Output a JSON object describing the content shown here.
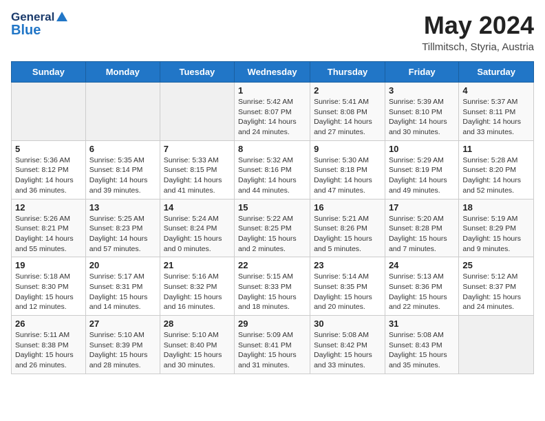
{
  "header": {
    "logo_line1": "General",
    "logo_line2": "Blue",
    "month": "May 2024",
    "location": "Tillmitsch, Styria, Austria"
  },
  "weekdays": [
    "Sunday",
    "Monday",
    "Tuesday",
    "Wednesday",
    "Thursday",
    "Friday",
    "Saturday"
  ],
  "weeks": [
    [
      {
        "day": "",
        "info": ""
      },
      {
        "day": "",
        "info": ""
      },
      {
        "day": "",
        "info": ""
      },
      {
        "day": "1",
        "info": "Sunrise: 5:42 AM\nSunset: 8:07 PM\nDaylight: 14 hours and 24 minutes."
      },
      {
        "day": "2",
        "info": "Sunrise: 5:41 AM\nSunset: 8:08 PM\nDaylight: 14 hours and 27 minutes."
      },
      {
        "day": "3",
        "info": "Sunrise: 5:39 AM\nSunset: 8:10 PM\nDaylight: 14 hours and 30 minutes."
      },
      {
        "day": "4",
        "info": "Sunrise: 5:37 AM\nSunset: 8:11 PM\nDaylight: 14 hours and 33 minutes."
      }
    ],
    [
      {
        "day": "5",
        "info": "Sunrise: 5:36 AM\nSunset: 8:12 PM\nDaylight: 14 hours and 36 minutes."
      },
      {
        "day": "6",
        "info": "Sunrise: 5:35 AM\nSunset: 8:14 PM\nDaylight: 14 hours and 39 minutes."
      },
      {
        "day": "7",
        "info": "Sunrise: 5:33 AM\nSunset: 8:15 PM\nDaylight: 14 hours and 41 minutes."
      },
      {
        "day": "8",
        "info": "Sunrise: 5:32 AM\nSunset: 8:16 PM\nDaylight: 14 hours and 44 minutes."
      },
      {
        "day": "9",
        "info": "Sunrise: 5:30 AM\nSunset: 8:18 PM\nDaylight: 14 hours and 47 minutes."
      },
      {
        "day": "10",
        "info": "Sunrise: 5:29 AM\nSunset: 8:19 PM\nDaylight: 14 hours and 49 minutes."
      },
      {
        "day": "11",
        "info": "Sunrise: 5:28 AM\nSunset: 8:20 PM\nDaylight: 14 hours and 52 minutes."
      }
    ],
    [
      {
        "day": "12",
        "info": "Sunrise: 5:26 AM\nSunset: 8:21 PM\nDaylight: 14 hours and 55 minutes."
      },
      {
        "day": "13",
        "info": "Sunrise: 5:25 AM\nSunset: 8:23 PM\nDaylight: 14 hours and 57 minutes."
      },
      {
        "day": "14",
        "info": "Sunrise: 5:24 AM\nSunset: 8:24 PM\nDaylight: 15 hours and 0 minutes."
      },
      {
        "day": "15",
        "info": "Sunrise: 5:22 AM\nSunset: 8:25 PM\nDaylight: 15 hours and 2 minutes."
      },
      {
        "day": "16",
        "info": "Sunrise: 5:21 AM\nSunset: 8:26 PM\nDaylight: 15 hours and 5 minutes."
      },
      {
        "day": "17",
        "info": "Sunrise: 5:20 AM\nSunset: 8:28 PM\nDaylight: 15 hours and 7 minutes."
      },
      {
        "day": "18",
        "info": "Sunrise: 5:19 AM\nSunset: 8:29 PM\nDaylight: 15 hours and 9 minutes."
      }
    ],
    [
      {
        "day": "19",
        "info": "Sunrise: 5:18 AM\nSunset: 8:30 PM\nDaylight: 15 hours and 12 minutes."
      },
      {
        "day": "20",
        "info": "Sunrise: 5:17 AM\nSunset: 8:31 PM\nDaylight: 15 hours and 14 minutes."
      },
      {
        "day": "21",
        "info": "Sunrise: 5:16 AM\nSunset: 8:32 PM\nDaylight: 15 hours and 16 minutes."
      },
      {
        "day": "22",
        "info": "Sunrise: 5:15 AM\nSunset: 8:33 PM\nDaylight: 15 hours and 18 minutes."
      },
      {
        "day": "23",
        "info": "Sunrise: 5:14 AM\nSunset: 8:35 PM\nDaylight: 15 hours and 20 minutes."
      },
      {
        "day": "24",
        "info": "Sunrise: 5:13 AM\nSunset: 8:36 PM\nDaylight: 15 hours and 22 minutes."
      },
      {
        "day": "25",
        "info": "Sunrise: 5:12 AM\nSunset: 8:37 PM\nDaylight: 15 hours and 24 minutes."
      }
    ],
    [
      {
        "day": "26",
        "info": "Sunrise: 5:11 AM\nSunset: 8:38 PM\nDaylight: 15 hours and 26 minutes."
      },
      {
        "day": "27",
        "info": "Sunrise: 5:10 AM\nSunset: 8:39 PM\nDaylight: 15 hours and 28 minutes."
      },
      {
        "day": "28",
        "info": "Sunrise: 5:10 AM\nSunset: 8:40 PM\nDaylight: 15 hours and 30 minutes."
      },
      {
        "day": "29",
        "info": "Sunrise: 5:09 AM\nSunset: 8:41 PM\nDaylight: 15 hours and 31 minutes."
      },
      {
        "day": "30",
        "info": "Sunrise: 5:08 AM\nSunset: 8:42 PM\nDaylight: 15 hours and 33 minutes."
      },
      {
        "day": "31",
        "info": "Sunrise: 5:08 AM\nSunset: 8:43 PM\nDaylight: 15 hours and 35 minutes."
      },
      {
        "day": "",
        "info": ""
      }
    ]
  ]
}
